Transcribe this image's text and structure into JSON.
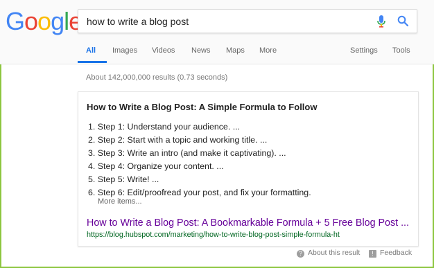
{
  "logo": {
    "letters": [
      "G",
      "o",
      "o",
      "g",
      "l",
      "e"
    ],
    "colors": [
      "#4285F4",
      "#EA4335",
      "#FBBC05",
      "#4285F4",
      "#34A853",
      "#EA4335"
    ]
  },
  "search": {
    "query": "how to write a blog post"
  },
  "tabs": {
    "all": "All",
    "images": "Images",
    "videos": "Videos",
    "news": "News",
    "maps": "Maps",
    "more": "More",
    "settings": "Settings",
    "tools": "Tools"
  },
  "results": {
    "count": "About 142,000,000 results (0.73 seconds)"
  },
  "snippet": {
    "title": "How to Write a Blog Post: A Simple Formula to Follow",
    "steps": [
      "1. Step 1: Understand your audience. ...",
      "2. Step 2: Start with a topic and working title. ...",
      "3. Step 3: Write an intro (and make it captivating). ...",
      "4. Step 4: Organize your content. ...",
      "5. Step 5: Write! ...",
      "6. Step 6: Edit/proofread your post, and fix your formatting."
    ],
    "more_items": "More items...",
    "link_title": "How to Write a Blog Post: A Bookmarkable Formula + 5 Free Blog Post ...",
    "url": "https://blog.hubspot.com/marketing/how-to-write-blog-post-simple-formula-ht"
  },
  "footer": {
    "about": "About this result",
    "feedback": "Feedback"
  },
  "colors": {
    "accent": "#1a73e8",
    "visited_link": "#660099",
    "url_green": "#006621",
    "frame": "#8dc63f"
  }
}
